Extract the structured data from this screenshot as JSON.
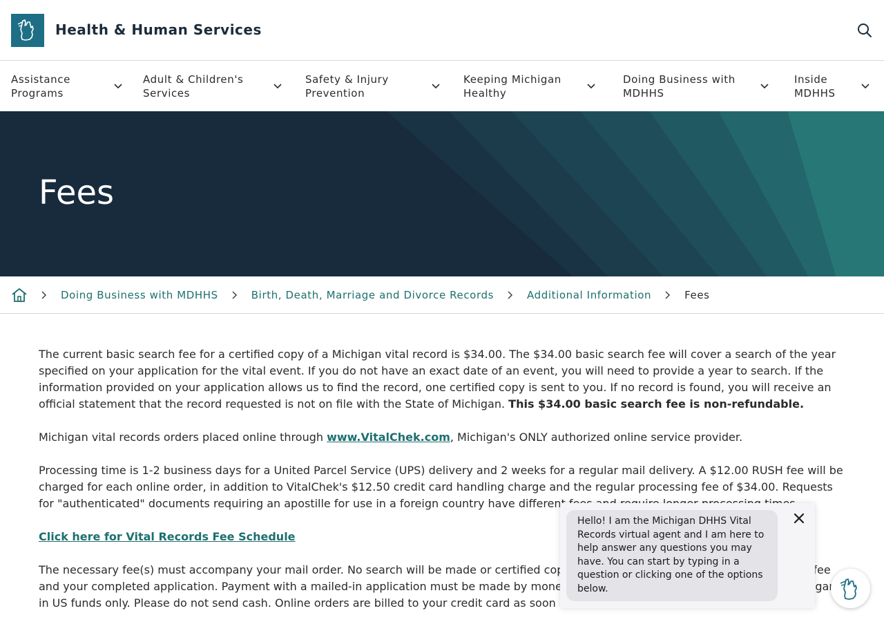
{
  "header": {
    "site_title": "Health & Human Services",
    "logo_icon": "michigan-mitten-icon",
    "search_icon": "search-icon"
  },
  "nav": {
    "items": [
      {
        "label": "Assistance Programs"
      },
      {
        "label": "Adult & Children's Services"
      },
      {
        "label": "Safety & Injury Prevention"
      },
      {
        "label": "Keeping Michigan Healthy"
      },
      {
        "label": "Doing Business with MDHHS"
      },
      {
        "label": "Inside MDHHS"
      }
    ]
  },
  "hero": {
    "title": "Fees"
  },
  "breadcrumb": {
    "home_icon": "home-icon",
    "links": [
      "Doing Business with MDHHS",
      "Birth, Death, Marriage and Divorce Records",
      "Additional Information"
    ],
    "current": "Fees"
  },
  "content": {
    "p1_text": "The current basic search fee for a certified copy of a Michigan vital record is $34.00. The $34.00 basic search fee will cover a search of the year specified on your application for the vital event. If you do not have an exact date of an event, you will need to provide a year to search. If the information provided on your application allows us to find the record, one certified copy is sent to you. If no record is found, you will receive an official statement that the record requested is not on file with the State of Michigan. ",
    "p1_bold": "This $34.00 basic search fee is non-refundable.",
    "p2_before": "Michigan vital records orders placed online through ",
    "p2_link": "www.VitalChek.com",
    "p2_after": ", Michigan's ONLY authorized online service provider.",
    "p3_text": "Processing time is 1-2 business days for a United Parcel Service (UPS) delivery and 2 weeks for a regular mail delivery. A $12.00 RUSH fee will be charged for each online order, in addition to VitalChek's $12.50 credit card handling charge and the regular processing fee of $34.00.  Requests for \"authenticated\" documents requiring an apostille for use in a foreign country have different fees and require longer processing times.",
    "p4_link": "Click here for Vital Records Fee Schedule",
    "p5_text": "The necessary fee(s) must accompany your mail order. No search will be made or certified copy issued until we have received the required fee and your completed application. Payment with a mailed-in application must be made by money order or check payable to the State of Michigan in US funds only. Please do not send cash. Online orders are billed to your credit card as soon as the order is submitted."
  },
  "chat": {
    "message": "Hello! I am the Michigan DHHS Vital Records virtual agent and I am here to help answer any questions you may have. You can start by typing in a question or clicking one of the options below.",
    "close_icon": "close-icon",
    "launcher_icon": "michigan-mitten-chat-icon"
  },
  "colors": {
    "brand_teal": "#1e6f86",
    "link_teal": "#1e6f6f",
    "hero_navy": "#182b3d"
  }
}
